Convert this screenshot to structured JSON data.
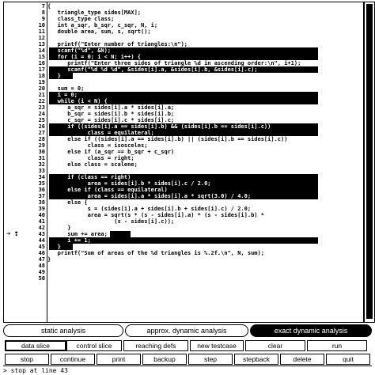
{
  "code": {
    "lines": [
      {
        "n": "7",
        "text": "{"
      },
      {
        "n": "8",
        "text": "   triangle_type sides[MAX];"
      },
      {
        "n": "9",
        "text": "   class_type class;"
      },
      {
        "n": "10",
        "text": "   int a_sqr, b_sqr, c_sqr, N, i;"
      },
      {
        "n": "11",
        "text": "   double area, sum, s, sqrt();"
      },
      {
        "n": "12",
        "text": ""
      },
      {
        "n": "13",
        "text": "   printf(\"Enter number of triangles:\\n\");"
      },
      {
        "n": "14",
        "text": "   scanf(\"%d\", &N);",
        "hl": "full"
      },
      {
        "n": "15",
        "text": "   for (i = 0; i < N; i++) {",
        "hl": "full"
      },
      {
        "n": "16",
        "text": "      printf(\"Enter three sides of triangle %d in ascending order:\\n\", i+1);"
      },
      {
        "n": "17",
        "text": "      scanf(\"%d %d %d\", &sides[i].a, &sides[i].b, &sides[i].c);",
        "hl": "full"
      },
      {
        "n": "18",
        "text": "   }",
        "hl": "short"
      },
      {
        "n": "19",
        "text": ""
      },
      {
        "n": "20",
        "text": "   sum = 0;"
      },
      {
        "n": "21",
        "text": "   i = 0;",
        "hl": "full"
      },
      {
        "n": "22",
        "text": "   while (i < N) {",
        "hl": "full"
      },
      {
        "n": "23",
        "text": "      a_sqr = sides[i].a * sides[i].a;"
      },
      {
        "n": "24",
        "text": "      b_sqr = sides[i].b * sides[i].b;"
      },
      {
        "n": "25",
        "text": "      c_sqr = sides[i].c * sides[i].c;"
      },
      {
        "n": "26",
        "text": "      if ((sides[i].a == sides[i].b) && (sides[i].b == sides[i].c))",
        "hl": "full"
      },
      {
        "n": "27",
        "text": "            class = equilateral;",
        "hl": "full"
      },
      {
        "n": "28",
        "text": "      else if ((sides[i].a == sides[i].b) || (sides[i].b == sides[i].c))"
      },
      {
        "n": "29",
        "text": "            class = isosceles;"
      },
      {
        "n": "30",
        "text": "      else if (a_sqr == b_sqr + c_sqr)"
      },
      {
        "n": "31",
        "text": "            class = right;"
      },
      {
        "n": "32",
        "text": "      else class = scalene;"
      },
      {
        "n": "33",
        "text": ""
      },
      {
        "n": "34",
        "text": "      if (class == right)",
        "hl": "full"
      },
      {
        "n": "35",
        "text": "            area = sides[i].b * sides[i].c / 2.0;",
        "hl": "full"
      },
      {
        "n": "36",
        "text": "      else if (class == equilateral)",
        "hl": "full"
      },
      {
        "n": "37",
        "text": "            area = sides[i].a * sides[i].a * sqrt(3.0) / 4.0;",
        "hl": "full"
      },
      {
        "n": "38",
        "text": "      else {"
      },
      {
        "n": "39",
        "text": "            s = (sides[i].a + sides[i].b + sides[i].c) / 2.0;"
      },
      {
        "n": "40",
        "text": "            area = sqrt(s * (s - sides[i].a) * (s - sides[i].b) *"
      },
      {
        "n": "41",
        "text": "                    (s - sides[i].c));"
      },
      {
        "n": "42",
        "text": "      }"
      },
      {
        "n": "43",
        "text": "      sum += area;",
        "hl": "word"
      },
      {
        "n": "44",
        "text": "      i += 1;",
        "hl": "full"
      },
      {
        "n": "45",
        "text": "   }",
        "hl": "short"
      },
      {
        "n": "46",
        "text": "   printf(\"Sum of areas of the %d triangles is %.2f.\\n\", N, sum);"
      },
      {
        "n": "47",
        "text": "}"
      },
      {
        "n": "48",
        "text": ""
      },
      {
        "n": "49",
        "text": ""
      },
      {
        "n": "50",
        "text": ""
      }
    ],
    "current_line_marker": "➔",
    "breakpoint_marker": "❢"
  },
  "mode_tabs": [
    {
      "label": "static analysis",
      "active": false
    },
    {
      "label": "approx. dynamic analysis",
      "active": false
    },
    {
      "label": "exact dynamic analysis",
      "active": true
    }
  ],
  "toolbar_row1": [
    {
      "label": "data slice",
      "selected": true
    },
    {
      "label": "control slice"
    },
    {
      "label": "reaching defs"
    },
    {
      "label": "new testcase"
    },
    {
      "label": "clear"
    },
    {
      "label": "run"
    }
  ],
  "toolbar_row2": [
    {
      "label": "stop"
    },
    {
      "label": "continue"
    },
    {
      "label": "print"
    },
    {
      "label": "backup"
    },
    {
      "label": "step"
    },
    {
      "label": "stepback"
    },
    {
      "label": "delete"
    },
    {
      "label": "quit"
    }
  ],
  "status": {
    "prompt": ">",
    "text": "stop at line 43"
  }
}
